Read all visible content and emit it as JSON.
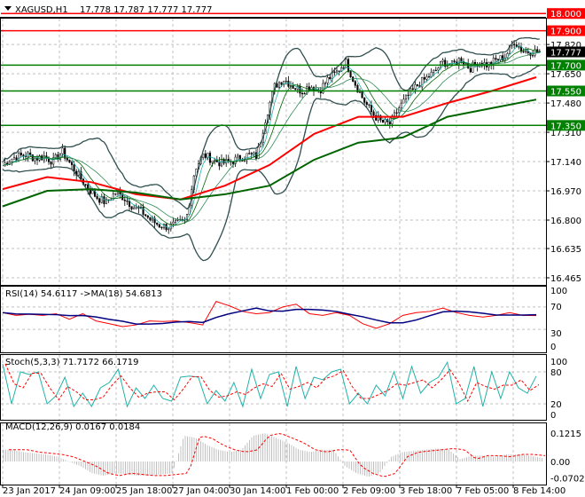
{
  "header": {
    "symbol": "XAGUSD,H1",
    "ohlc": "17.778 17.787 17.777 17.777"
  },
  "colors": {
    "resistance": "#ff0000",
    "support": "#008000",
    "ma_fast": "#ff0000",
    "ma_slow": "#006400",
    "bands": "#2f4f4f",
    "rsi": "#ff0000",
    "rsi_ma": "#000080",
    "stoch_main": "#20b2aa",
    "stoch_signal": "#ff0000",
    "macd_hist": "#c0c0c0",
    "macd_signal": "#ff0000"
  },
  "chart_data": [
    {
      "type": "candlestick",
      "title": "XAGUSD,H1",
      "ylim": [
        16.465,
        18.0
      ],
      "y_ticks": [
        "17.820",
        "17.650",
        "17.480",
        "17.310",
        "17.140",
        "16.970",
        "16.800",
        "16.635",
        "16.465"
      ],
      "current_price": "17.777",
      "levels": [
        {
          "label": "18.000",
          "value": 18.0,
          "kind": "resistance"
        },
        {
          "label": "17.900",
          "value": 17.9,
          "kind": "resistance"
        },
        {
          "label": "17.700",
          "value": 17.7,
          "kind": "support"
        },
        {
          "label": "17.550",
          "value": 17.55,
          "kind": "support"
        },
        {
          "label": "17.350",
          "value": 17.35,
          "kind": "support"
        }
      ],
      "x_labels": [
        "23 Jan 2017",
        "24 Jan 09:00",
        "25 Jan 18:00",
        "27 Jan 04:00",
        "30 Jan 14:00",
        "1 Feb 00:00",
        "2 Feb 09:00",
        "3 Feb 18:00",
        "7 Feb 05:00",
        "8 Feb 14:00"
      ],
      "close": [
        17.1,
        17.15,
        17.17,
        17.18,
        17.16,
        17.17,
        17.14,
        17.2,
        17.12,
        17.05,
        16.98,
        16.93,
        16.9,
        16.96,
        16.93,
        16.88,
        16.85,
        16.8,
        16.77,
        16.76,
        16.78,
        16.8,
        17.1,
        17.18,
        17.15,
        17.13,
        17.14,
        17.16,
        17.18,
        17.17,
        17.4,
        17.58,
        17.62,
        17.58,
        17.55,
        17.58,
        17.55,
        17.62,
        17.66,
        17.72,
        17.6,
        17.5,
        17.42,
        17.37,
        17.36,
        17.45,
        17.52,
        17.58,
        17.62,
        17.66,
        17.72,
        17.7,
        17.74,
        17.68,
        17.72,
        17.7,
        17.73,
        17.75,
        17.84,
        17.78,
        17.78,
        17.777
      ],
      "ma_red": [
        16.98,
        17.05,
        17.02,
        16.95,
        16.92,
        17.0,
        17.12,
        17.3,
        17.4,
        17.4,
        17.48,
        17.55,
        17.63
      ],
      "ma_green": [
        16.88,
        16.97,
        16.98,
        16.96,
        16.92,
        16.95,
        17.0,
        17.15,
        17.25,
        17.28,
        17.4,
        17.45,
        17.5
      ]
    },
    {
      "type": "line",
      "title": "RSI(14) 54.6117  ->MA(18) 54.6813",
      "ylim": [
        0,
        100
      ],
      "y_ticks": [
        "100",
        "70",
        "30",
        "0"
      ],
      "values": [
        60,
        55,
        57,
        55,
        58,
        48,
        58,
        45,
        40,
        35,
        38,
        45,
        44,
        45,
        42,
        38,
        80,
        72,
        62,
        58,
        60,
        70,
        75,
        58,
        55,
        60,
        55,
        40,
        32,
        40,
        55,
        60,
        62,
        68,
        60,
        55,
        52,
        55,
        60,
        55,
        54.6
      ]
    },
    {
      "type": "line",
      "title": "Stoch(5,3,3) 71.7172 66.1719",
      "ylim": [
        0,
        100
      ],
      "y_ticks": [
        "100",
        "80",
        "20",
        "0"
      ],
      "values": [
        95,
        20,
        80,
        75,
        80,
        20,
        35,
        70,
        15,
        40,
        15,
        50,
        60,
        85,
        15,
        50,
        30,
        55,
        30,
        25,
        70,
        72,
        70,
        20,
        45,
        25,
        60,
        15,
        85,
        30,
        75,
        80,
        15,
        90,
        30,
        70,
        65,
        80,
        85,
        20,
        40,
        20,
        55,
        35,
        80,
        30,
        90,
        40,
        60,
        70,
        98,
        20,
        30,
        90,
        15,
        80,
        30,
        80,
        50,
        40,
        72
      ]
    },
    {
      "type": "bar",
      "title": "MACD(12,26,9) 0.0167 0.0184",
      "ylim": [
        -0.0702,
        0.1215
      ],
      "y_ticks": [
        "0.1215",
        "0.00",
        "-0.0702"
      ],
      "values": [
        0.05,
        0.05,
        0.04,
        0.035,
        0.03,
        0.02,
        0.0,
        -0.02,
        -0.05,
        -0.06,
        -0.05,
        -0.055,
        -0.06,
        -0.06,
        -0.055,
        -0.05,
        0.11,
        0.1,
        0.07,
        0.05,
        0.04,
        0.05,
        0.11,
        0.12,
        0.1,
        0.08,
        0.05,
        0.04,
        0.05,
        0.05,
        -0.02,
        -0.05,
        -0.065,
        -0.05,
        0.02,
        0.04,
        0.045,
        0.05,
        0.055,
        0.05,
        0.01,
        0.025,
        0.025,
        0.02,
        0.03,
        0.03,
        0.025,
        0.0167
      ]
    }
  ]
}
